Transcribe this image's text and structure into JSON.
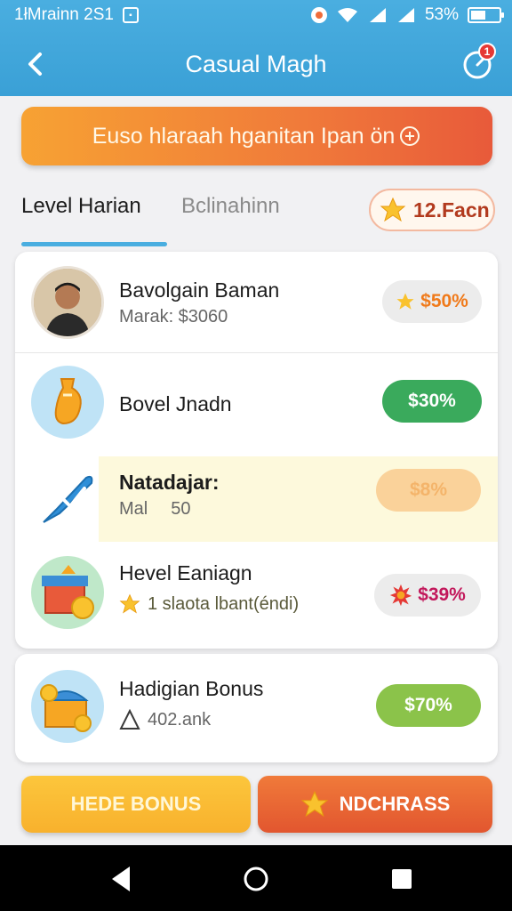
{
  "status_bar": {
    "time": "1łMrainn 2S1",
    "battery": "53%",
    "battery_level": 0.53
  },
  "app_bar": {
    "title": "Casual Magh",
    "notification_count": "1"
  },
  "promo_banner": {
    "text": "Euso hlaraah hganitan Ipan ön"
  },
  "tabs": [
    {
      "label": "Level Harian",
      "active": true
    },
    {
      "label": "Bclinahinn",
      "active": false
    }
  ],
  "coin_chip": {
    "label": "12.Facn"
  },
  "items": [
    {
      "title": "Bavolgain Baman",
      "subtitle": "Marak: $3060",
      "pill": "$50%",
      "pill_color": "#ececec",
      "pill_text_color": "#f07a1a"
    },
    {
      "title": "Bovel Jnadn",
      "subtitle": "",
      "pill": "$30%",
      "pill_color": "#3aaa5c",
      "pill_text_color": "#ffffff"
    },
    {
      "title": "Natadajar:",
      "subtitle_left": "Mal",
      "subtitle_right": "50",
      "pill": "$8%",
      "pill_color": "#fad29a",
      "pill_text_color": "#f4b46a"
    },
    {
      "title": "Hevel Eaniagn",
      "subtitle": "1 slaota lbant(éndi)",
      "pill": "$39%",
      "pill_color": "#ececec",
      "pill_text_color": "#c2185b"
    }
  ],
  "bonus_item": {
    "title": "Hadigian Bonus",
    "subtitle": "402.ank",
    "pill": "$70%",
    "pill_color": "#8bc34a",
    "pill_text_color": "#ffffff"
  },
  "buttons": {
    "left": "HEDE BONUS",
    "right": "NDCHRASS"
  },
  "colors": {
    "header": "#3aa0d6",
    "accent_orange": "#f07a3a",
    "accent_yellow": "#f8b12d",
    "tab_indicator": "#4aaee0"
  }
}
